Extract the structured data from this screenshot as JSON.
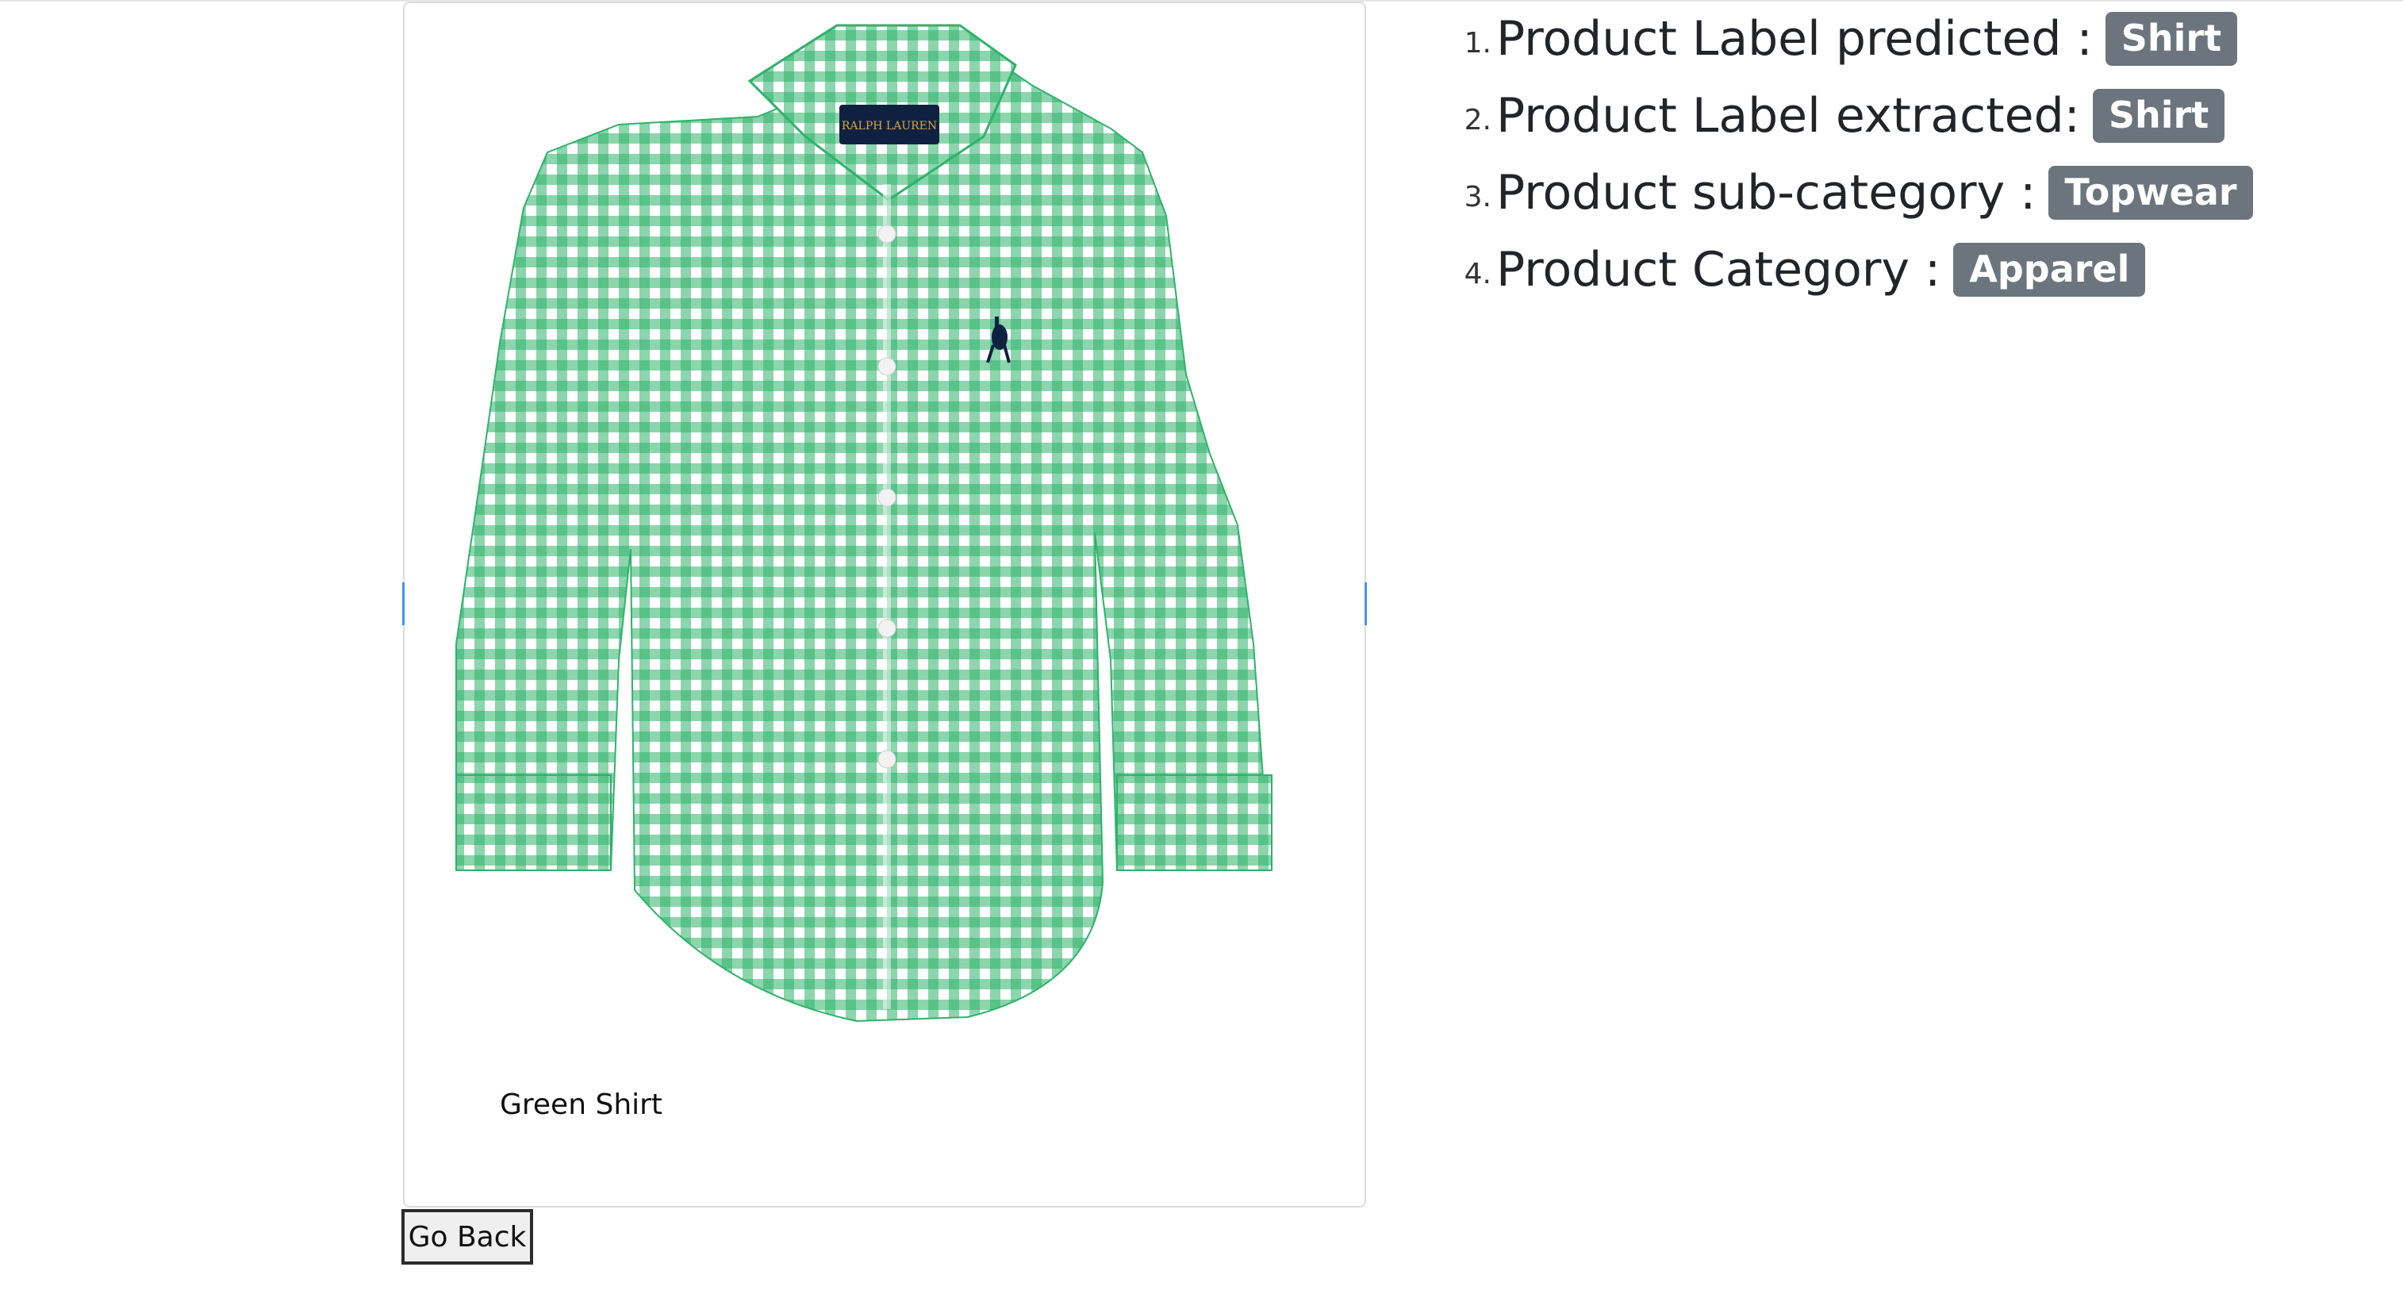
{
  "product": {
    "caption": "Green Shirt",
    "image_icon": "green-gingham-shirt-image",
    "brand_label_text": "RALPH LAUREN",
    "colors": {
      "shirt_green": "#2db36a",
      "logo_navy": "#0f2140",
      "logo_gold": "#d9a441"
    }
  },
  "info": {
    "items": [
      {
        "number": "1.",
        "label": "Product Label predicted :",
        "value": "Shirt"
      },
      {
        "number": "2.",
        "label": "Product Label extracted:",
        "value": "Shirt"
      },
      {
        "number": "3.",
        "label": "Product sub-category :",
        "value": "Topwear"
      },
      {
        "number": "4.",
        "label": "Product Category :",
        "value": "Apparel"
      }
    ],
    "badge_color": "#6c757d"
  },
  "actions": {
    "go_back_label": "Go Back"
  }
}
